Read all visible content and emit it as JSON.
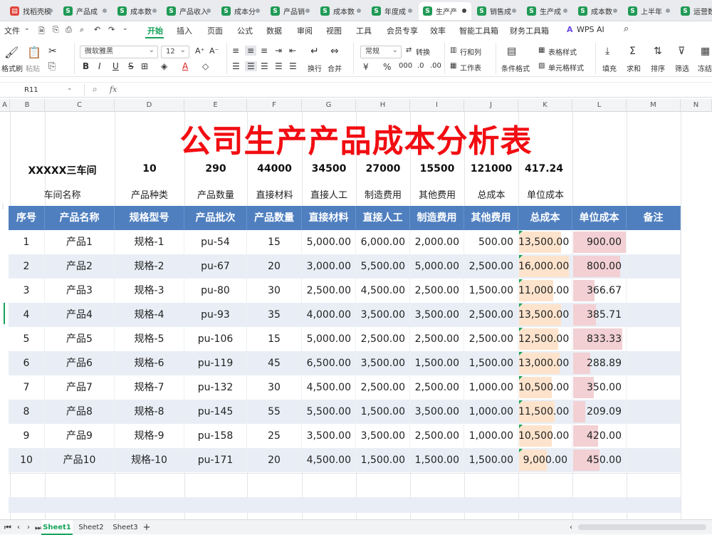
{
  "tabs": [
    {
      "label": "找稻壳模",
      "icon": "pdf"
    },
    {
      "label": "产品成",
      "icon": "S"
    },
    {
      "label": "成本数",
      "icon": "S"
    },
    {
      "label": "产品收入",
      "icon": "S"
    },
    {
      "label": "成本分",
      "icon": "S"
    },
    {
      "label": "产品销",
      "icon": "S"
    },
    {
      "label": "成本数",
      "icon": "S"
    },
    {
      "label": "年度成",
      "icon": "S"
    },
    {
      "label": "生产产",
      "icon": "S"
    },
    {
      "label": "销售成",
      "icon": "S"
    },
    {
      "label": "生产成",
      "icon": "S"
    },
    {
      "label": "成本数",
      "icon": "S"
    },
    {
      "label": "上半年",
      "icon": "S"
    },
    {
      "label": "运营数",
      "icon": "S"
    }
  ],
  "menu": {
    "file": "文件",
    "items": [
      "开始",
      "插入",
      "页面",
      "公式",
      "数据",
      "审阅",
      "视图",
      "工具",
      "会员专享",
      "效率",
      "智能工具箱",
      "财务工具箱",
      "WPS AI"
    ]
  },
  "ribbon": {
    "format_painter": "格式刷",
    "paste": "粘贴",
    "font": "微软雅黑",
    "size": "12",
    "wrap": "换行",
    "merge": "合并",
    "number_format": "常规",
    "convert": "转换",
    "row_col": "行和列",
    "worksheet": "工作表",
    "cond_format": "条件格式",
    "table_style": "表格样式",
    "cell_style": "单元格样式",
    "fill": "填充",
    "sum": "求和",
    "sort": "排序",
    "filter": "筛选",
    "more": "冻结"
  },
  "formula_bar": {
    "cell_ref": "R11",
    "fx": "fx"
  },
  "columns": [
    "A",
    "B",
    "C",
    "D",
    "E",
    "F",
    "G",
    "H",
    "I",
    "J",
    "K",
    "L",
    "M",
    "N"
  ],
  "title": "公司生产产品成本分析表",
  "summary": {
    "values": [
      "XXXXX三车间",
      "10",
      "290",
      "44000",
      "34500",
      "27000",
      "15500",
      "121000",
      "417.24"
    ],
    "labels": [
      "车间名称",
      "产品种类",
      "产品数量",
      "直接材料",
      "直接人工",
      "制造费用",
      "其他费用",
      "总成本",
      "单位成本"
    ]
  },
  "table": {
    "headers": [
      "序号",
      "产品名称",
      "规格型号",
      "产品批次",
      "产品数量",
      "直接材料",
      "直接人工",
      "制造费用",
      "其他费用",
      "总成本",
      "单位成本",
      "备注"
    ],
    "rows": [
      [
        "1",
        "产品1",
        "规格-1",
        "pu-54",
        "15",
        "5,000.00",
        "6,000.00",
        "2,000.00",
        "500.00",
        "13,500.00",
        "900.00",
        ""
      ],
      [
        "2",
        "产品2",
        "规格-2",
        "pu-67",
        "20",
        "3,000.00",
        "5,500.00",
        "5,000.00",
        "2,500.00",
        "16,000.00",
        "800.00",
        ""
      ],
      [
        "3",
        "产品3",
        "规格-3",
        "pu-80",
        "30",
        "2,500.00",
        "4,500.00",
        "2,500.00",
        "1,500.00",
        "11,000.00",
        "366.67",
        ""
      ],
      [
        "4",
        "产品4",
        "规格-4",
        "pu-93",
        "35",
        "4,000.00",
        "3,500.00",
        "3,500.00",
        "2,500.00",
        "13,500.00",
        "385.71",
        ""
      ],
      [
        "5",
        "产品5",
        "规格-5",
        "pu-106",
        "15",
        "5,000.00",
        "2,500.00",
        "2,500.00",
        "2,500.00",
        "12,500.00",
        "833.33",
        ""
      ],
      [
        "6",
        "产品6",
        "规格-6",
        "pu-119",
        "45",
        "6,500.00",
        "3,500.00",
        "1,500.00",
        "1,500.00",
        "13,000.00",
        "288.89",
        ""
      ],
      [
        "7",
        "产品7",
        "规格-7",
        "pu-132",
        "30",
        "4,500.00",
        "2,500.00",
        "2,500.00",
        "1,000.00",
        "10,500.00",
        "350.00",
        ""
      ],
      [
        "8",
        "产品8",
        "规格-8",
        "pu-145",
        "55",
        "5,500.00",
        "1,500.00",
        "3,500.00",
        "1,000.00",
        "11,500.00",
        "209.09",
        ""
      ],
      [
        "9",
        "产品9",
        "规格-9",
        "pu-158",
        "25",
        "3,500.00",
        "3,500.00",
        "2,500.00",
        "1,000.00",
        "10,500.00",
        "420.00",
        ""
      ],
      [
        "10",
        "产品10",
        "规格-10",
        "pu-171",
        "20",
        "4,500.00",
        "1,500.00",
        "1,500.00",
        "1,500.00",
        "9,000.00",
        "450.00",
        ""
      ]
    ],
    "total_cost_bar_fraction": [
      0.84,
      1.0,
      0.69,
      0.84,
      0.78,
      0.81,
      0.66,
      0.72,
      0.66,
      0.56
    ],
    "unit_cost_bar_fraction": [
      1.0,
      0.89,
      0.41,
      0.43,
      0.93,
      0.32,
      0.39,
      0.23,
      0.47,
      0.5
    ]
  },
  "sheets": [
    "Sheet1",
    "Sheet2",
    "Sheet3"
  ],
  "colors": {
    "accent": "#17a35a",
    "header": "#4f7fbf",
    "title": "#f10d12"
  }
}
